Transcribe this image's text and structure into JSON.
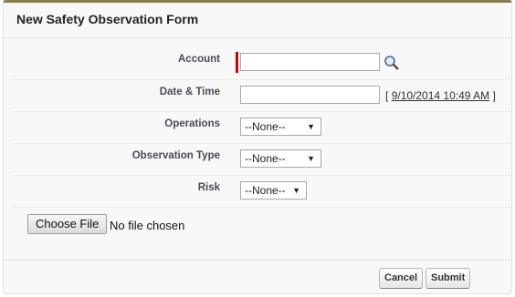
{
  "form": {
    "title": "New Safety Observation Form",
    "fields": {
      "account": {
        "label": "Account",
        "value": ""
      },
      "date_time": {
        "label": "Date & Time",
        "value": "",
        "open_bracket": "[",
        "now_link": "9/10/2014 10:49 AM",
        "close_bracket": "]"
      },
      "operations": {
        "label": "Operations",
        "selected": "--None--"
      },
      "observation_type": {
        "label": "Observation Type",
        "selected": "--None--"
      },
      "risk": {
        "label": "Risk",
        "selected": "--None--"
      }
    },
    "attachment": {
      "button_label": "Choose File",
      "status": "No file chosen"
    },
    "buttons": {
      "cancel": "Cancel",
      "submit": "Submit"
    }
  },
  "colors": {
    "required_marker": "#cc0000",
    "header_border": "#8d7d4a"
  },
  "icons": {
    "lookup": "magnifier-lookup-icon",
    "dropdown": "chevron-down-icon"
  }
}
